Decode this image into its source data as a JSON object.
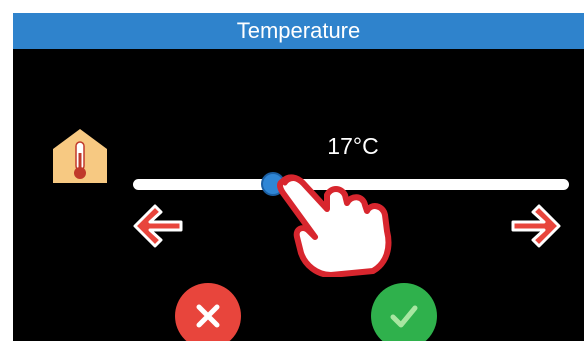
{
  "header": {
    "title": "Temperature"
  },
  "setting": {
    "value_text": "17°C"
  },
  "slider": {
    "fraction": 0.32
  },
  "icons": {
    "setting": "house-thermometer-icon",
    "decrease": "arrow-left-icon",
    "increase": "arrow-right-icon",
    "gesture": "hand-pointer-icon",
    "cancel": "close-icon",
    "confirm": "checkmark-icon"
  },
  "colors": {
    "title_bar": "#2f83cc",
    "background": "#000000",
    "slider_track": "#ffffff",
    "slider_thumb": "#2f86d6",
    "arrow": "#e8453c",
    "cancel": "#e8453c",
    "confirm": "#2fb14c",
    "house": "#f7c982"
  }
}
